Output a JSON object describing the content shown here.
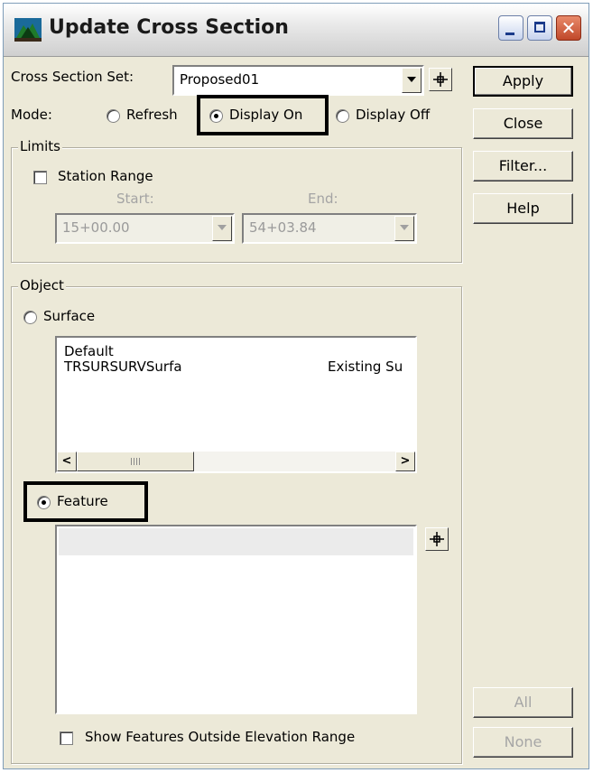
{
  "window": {
    "title": "Update Cross Section",
    "accent": "#7f9db9"
  },
  "cross_section_set": {
    "label": "Cross Section Set:",
    "value": "Proposed01"
  },
  "mode": {
    "label": "Mode:",
    "options": [
      "Refresh",
      "Display On",
      "Display Off"
    ],
    "selected": "Display On"
  },
  "limits": {
    "group_label": "Limits",
    "station_range_label": "Station Range",
    "station_range_checked": false,
    "start_label": "Start:",
    "end_label": "End:",
    "start_value": "15+00.00",
    "end_value": "54+03.84"
  },
  "object": {
    "group_label": "Object",
    "surface_label": "Surface",
    "feature_label": "Feature",
    "selected": "Feature",
    "surfaces": [
      {
        "name": "Default",
        "desc": ""
      },
      {
        "name": "TRSURSURVSurfa",
        "desc": "Existing Su"
      }
    ],
    "show_outside_label": "Show Features Outside Elevation Range"
  },
  "buttons": {
    "apply": "Apply",
    "close": "Close",
    "filter": "Filter...",
    "help": "Help",
    "all": "All",
    "none": "None"
  }
}
